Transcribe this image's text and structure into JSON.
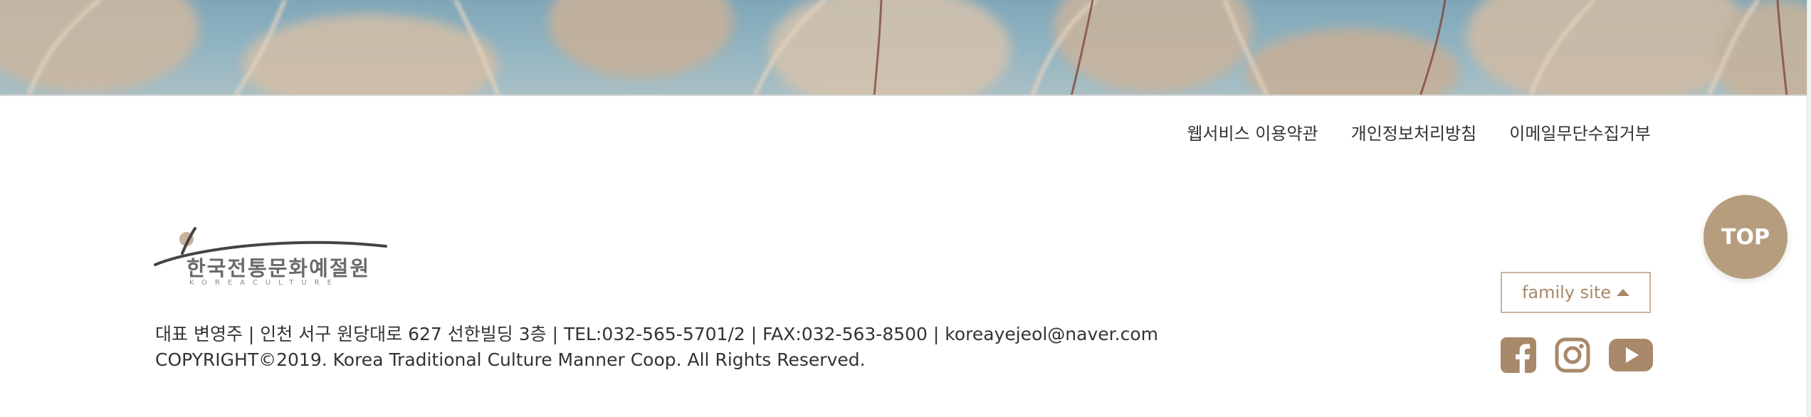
{
  "footer": {
    "links": [
      {
        "label": "웹서비스 이용약관"
      },
      {
        "label": "개인정보처리방침"
      },
      {
        "label": "이메일무단수집거부"
      }
    ],
    "logo": {
      "main_text": "한국전통문화예절원",
      "sub_text": "KOREACULTURE"
    },
    "address_line": "대표 변영주 | 인천 서구 원당대로 627 선한빌딩 3층 | TEL:032-565-5701/2 | FAX:032-563-8500 | koreayejeol@naver.com",
    "copyright": "COPYRIGHT©2019. Korea Traditional Culture Manner Coop. All Rights Reserved.",
    "family_site": {
      "label": "family site"
    },
    "social": [
      {
        "icon": "facebook-icon"
      },
      {
        "icon": "instagram-icon"
      },
      {
        "icon": "youtube-icon"
      }
    ]
  },
  "top_button": {
    "label": "TOP"
  },
  "colors": {
    "accent": "#b59d7d",
    "icon": "#a8896a",
    "text": "#333333"
  }
}
